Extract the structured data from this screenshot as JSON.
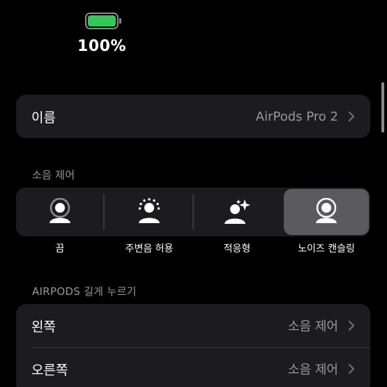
{
  "battery": {
    "percent_text": "100%",
    "level": 1.0,
    "color": "#34c759"
  },
  "name_row": {
    "label": "이름",
    "value": "AirPods Pro 2",
    "chevron_icon": "chevron-right-icon"
  },
  "noise_control": {
    "section_label": "소음 제어",
    "selected_index": 3,
    "options": [
      {
        "label": "끔",
        "icon": "person-off-icon"
      },
      {
        "label": "주변음 허용",
        "icon": "person-transparency-icon"
      },
      {
        "label": "적응형",
        "icon": "person-adaptive-icon"
      },
      {
        "label": "노이즈 캔슬링",
        "icon": "person-noise-cancel-icon"
      }
    ]
  },
  "press_hold": {
    "section_label": "AIRPODS 길게 누르기",
    "rows": [
      {
        "label": "왼쪽",
        "value": "소음 제어"
      },
      {
        "label": "오른쪽",
        "value": "소음 제어"
      }
    ]
  },
  "colors": {
    "background": "#000000",
    "group": "#1c1c1e",
    "secondary_text": "#98989d",
    "selected_segment": "#5b5b5f"
  }
}
